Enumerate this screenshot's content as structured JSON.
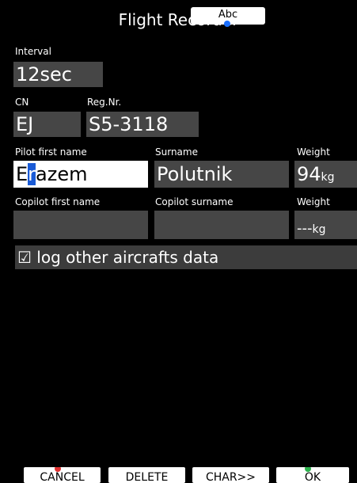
{
  "header": {
    "title": "Flight Recorder",
    "keyboard_mode": "Abc"
  },
  "interval": {
    "label": "Interval",
    "value": "12sec"
  },
  "cn": {
    "label": "CN",
    "value": "EJ"
  },
  "reg": {
    "label": "Reg.Nr.",
    "value": "S5-3118"
  },
  "pilot": {
    "first_label": "Pilot first name",
    "first_value": "Erazem",
    "surname_label": "Surname",
    "surname_value": "Polutnik",
    "weight_label": "Weight",
    "weight_value": "94",
    "weight_unit": "kg"
  },
  "copilot": {
    "first_label": "Copilot first name",
    "first_value": "",
    "surname_label": "Copilot surname",
    "surname_value": "",
    "weight_label": "Weight",
    "weight_value": "---",
    "weight_unit": "kg"
  },
  "log_other": {
    "label": "log other aircrafts data",
    "checked": true,
    "check_glyph": "☑"
  },
  "buttons": {
    "cancel": "CANCEL",
    "delete": "DELETE",
    "char": "CHAR>>",
    "ok": "OK"
  },
  "colors": {
    "background": "#000000",
    "field": "#464646",
    "active_field": "#ffffff",
    "cursor": "#1a5bd6",
    "cancel_mark": "#e03030",
    "ok_mark": "#2bb24c"
  }
}
